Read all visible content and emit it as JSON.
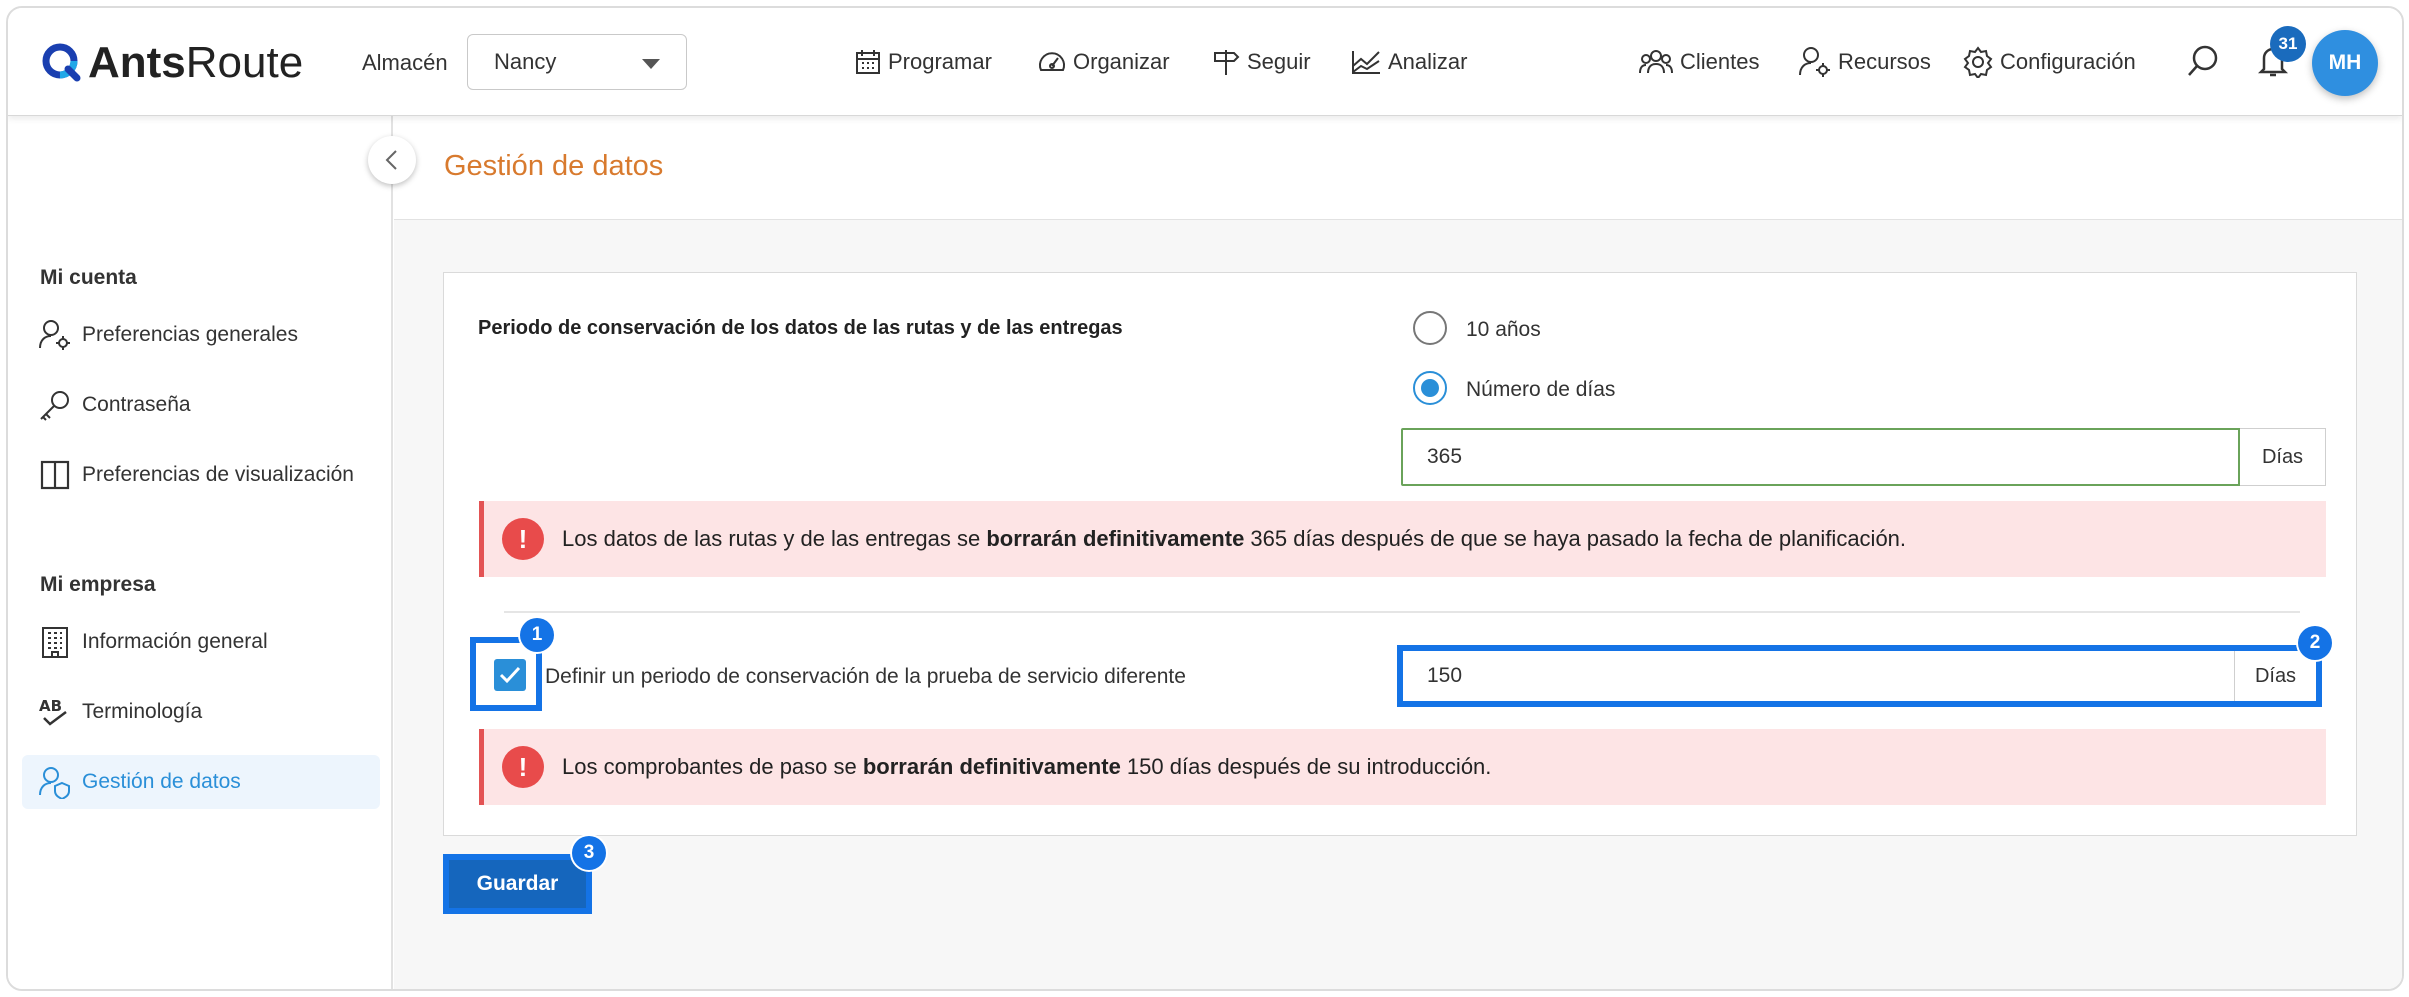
{
  "app": {
    "brand_bold": "Ants",
    "brand_light": "Route"
  },
  "header": {
    "warehouse_label": "Almacén",
    "warehouse_value": "Nancy",
    "nav": {
      "schedule": "Programar",
      "organize": "Organizar",
      "track": "Seguir",
      "analyze": "Analizar",
      "clients": "Clientes",
      "resources": "Recursos",
      "settings": "Configuración"
    },
    "notifications_count": "31",
    "avatar_initials": "MH"
  },
  "sidebar": {
    "account_section": "Mi cuenta",
    "account_items": [
      {
        "label": "Preferencias generales",
        "icon": "user-gear-icon"
      },
      {
        "label": "Contraseña",
        "icon": "key-icon"
      },
      {
        "label": "Preferencias de visualización",
        "icon": "columns-icon"
      }
    ],
    "company_section": "Mi empresa",
    "company_items": [
      {
        "label": "Información general",
        "icon": "building-icon"
      },
      {
        "label": "Terminología",
        "icon": "ab-check-icon"
      },
      {
        "label": "Gestión de datos",
        "icon": "user-shield-icon",
        "active": true
      }
    ]
  },
  "page": {
    "title": "Gestión de datos",
    "retention_title": "Periodo de conservación de los datos de las rutas y de las entregas",
    "option_10_years": "10 años",
    "option_days": "Número de días",
    "selected_option": "Número de días",
    "days_value": "365",
    "days_unit": "Días",
    "alert1": {
      "pre": "Los datos de las rutas y de las entregas se ",
      "bold": "borrarán definitivamente",
      "post": " 365 días después de que se haya pasado la fecha de planificación."
    },
    "pod_checkbox_label": "Definir un periodo de conservación de la prueba de servicio diferente",
    "pod_checked": true,
    "pod_days_value": "150",
    "pod_days_unit": "Días",
    "alert2": {
      "pre": "Los comprobantes de paso se ",
      "bold": "borrarán definitivamente",
      "post": " 150 días después de su introducción."
    },
    "save_label": "Guardar"
  },
  "annotations": {
    "step1": "1",
    "step2": "2",
    "step3": "3"
  },
  "colors": {
    "accent": "#2a8fd8",
    "highlight": "#1473e6",
    "title": "#d87a2e",
    "alert_bg": "#fde4e5",
    "alert_icon": "#e84b4b",
    "save_bg": "#1566bd"
  }
}
